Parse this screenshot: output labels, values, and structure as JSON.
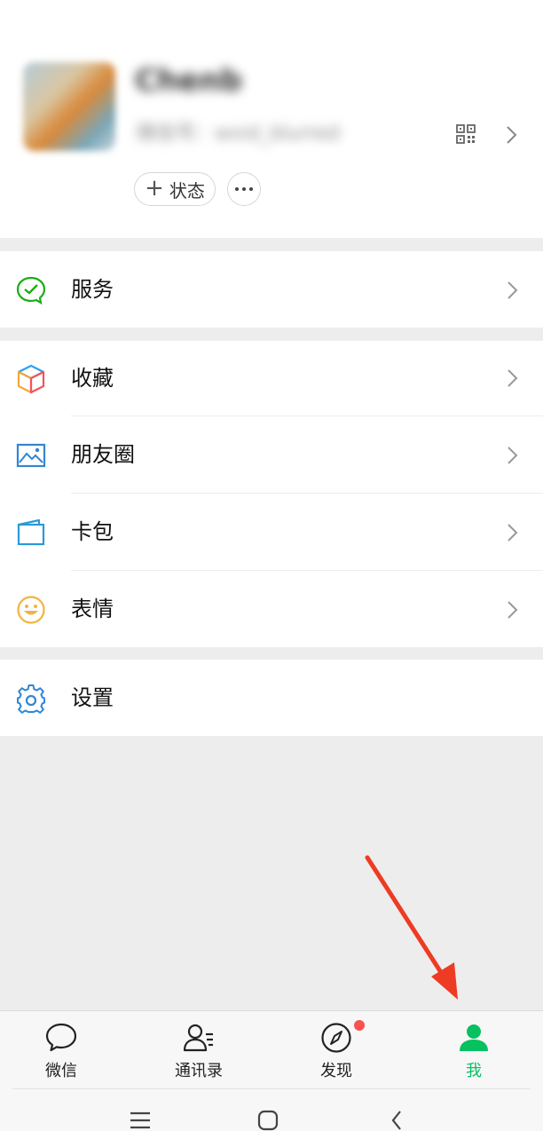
{
  "profile": {
    "nickname": "Chenb",
    "wechat_id": "微信号：wxid_blurred",
    "status_label": "状态"
  },
  "menu_groups": [
    {
      "items": [
        {
          "label": "服务"
        }
      ]
    },
    {
      "items": [
        {
          "label": "收藏"
        },
        {
          "label": "朋友圈"
        },
        {
          "label": "卡包"
        },
        {
          "label": "表情"
        }
      ]
    },
    {
      "items": [
        {
          "label": "设置"
        }
      ]
    }
  ],
  "tabbar": {
    "tabs": [
      {
        "label": "微信",
        "icon": "chat-bubble-icon",
        "active": false
      },
      {
        "label": "通讯录",
        "icon": "contacts-icon",
        "active": false
      },
      {
        "label": "发现",
        "icon": "compass-icon",
        "active": false,
        "badge": true
      },
      {
        "label": "我",
        "icon": "person-icon",
        "active": true
      }
    ]
  },
  "colors": {
    "accent_green": "#07c160",
    "badge_red": "#fa5151",
    "annotation_arrow": "#ee3b24",
    "background": "#ededed"
  },
  "icons": {
    "services": "service-check-icon",
    "favorites": "cube-icon",
    "moments": "image-icon",
    "cards": "card-wallet-icon",
    "stickers": "smiley-icon",
    "settings": "gear-icon"
  }
}
